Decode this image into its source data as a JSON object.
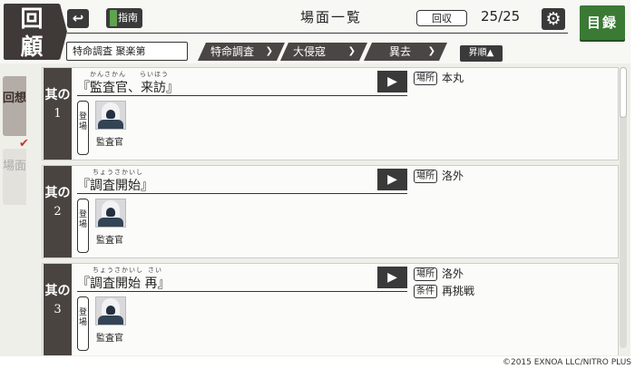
{
  "header": {
    "logo_line1": "回",
    "logo_line2": "顧",
    "back_icon": "↩",
    "guide_label": "指南",
    "title": "場面一覧",
    "collect_label": "回収",
    "count": "25/25",
    "settings_icon": "⚙",
    "catalog_label": "目録"
  },
  "filters": {
    "text_filter": "特命調査 聚楽第",
    "dropdowns": [
      {
        "label": "特命調査",
        "icon": "chevron-down-icon"
      },
      {
        "label": "大侵寇",
        "icon": "chevron-down-icon"
      },
      {
        "label": "異去",
        "icon": "chevron-down-icon"
      }
    ],
    "sort_label": "昇順▲"
  },
  "side_tabs": {
    "recall": "回想",
    "scenes": "場面",
    "check": "✔"
  },
  "cards": [
    {
      "num_label": "其の",
      "num": "1",
      "ruby": [
        "かんさかん",
        "らいほう"
      ],
      "title": "『監査官、来訪』",
      "tags": [
        {
          "tag": "場所",
          "value": "本丸"
        }
      ],
      "appear_label": "登場",
      "character": "監査官"
    },
    {
      "num_label": "其の",
      "num": "2",
      "ruby": [
        "ちょうさかいし"
      ],
      "title": "『調査開始』",
      "tags": [
        {
          "tag": "場所",
          "value": "洛外"
        }
      ],
      "appear_label": "登場",
      "character": "監査官"
    },
    {
      "num_label": "其の",
      "num": "3",
      "ruby": [
        "ちょうさかいし",
        "さい"
      ],
      "title": "『調査開始 再』",
      "tags": [
        {
          "tag": "場所",
          "value": "洛外"
        },
        {
          "tag": "条件",
          "value": "再挑戦"
        }
      ],
      "appear_label": "登場",
      "character": "監査官"
    }
  ],
  "play_icon": "▶",
  "copyright": "©2015 EXNOA LLC/NITRO PLUS"
}
